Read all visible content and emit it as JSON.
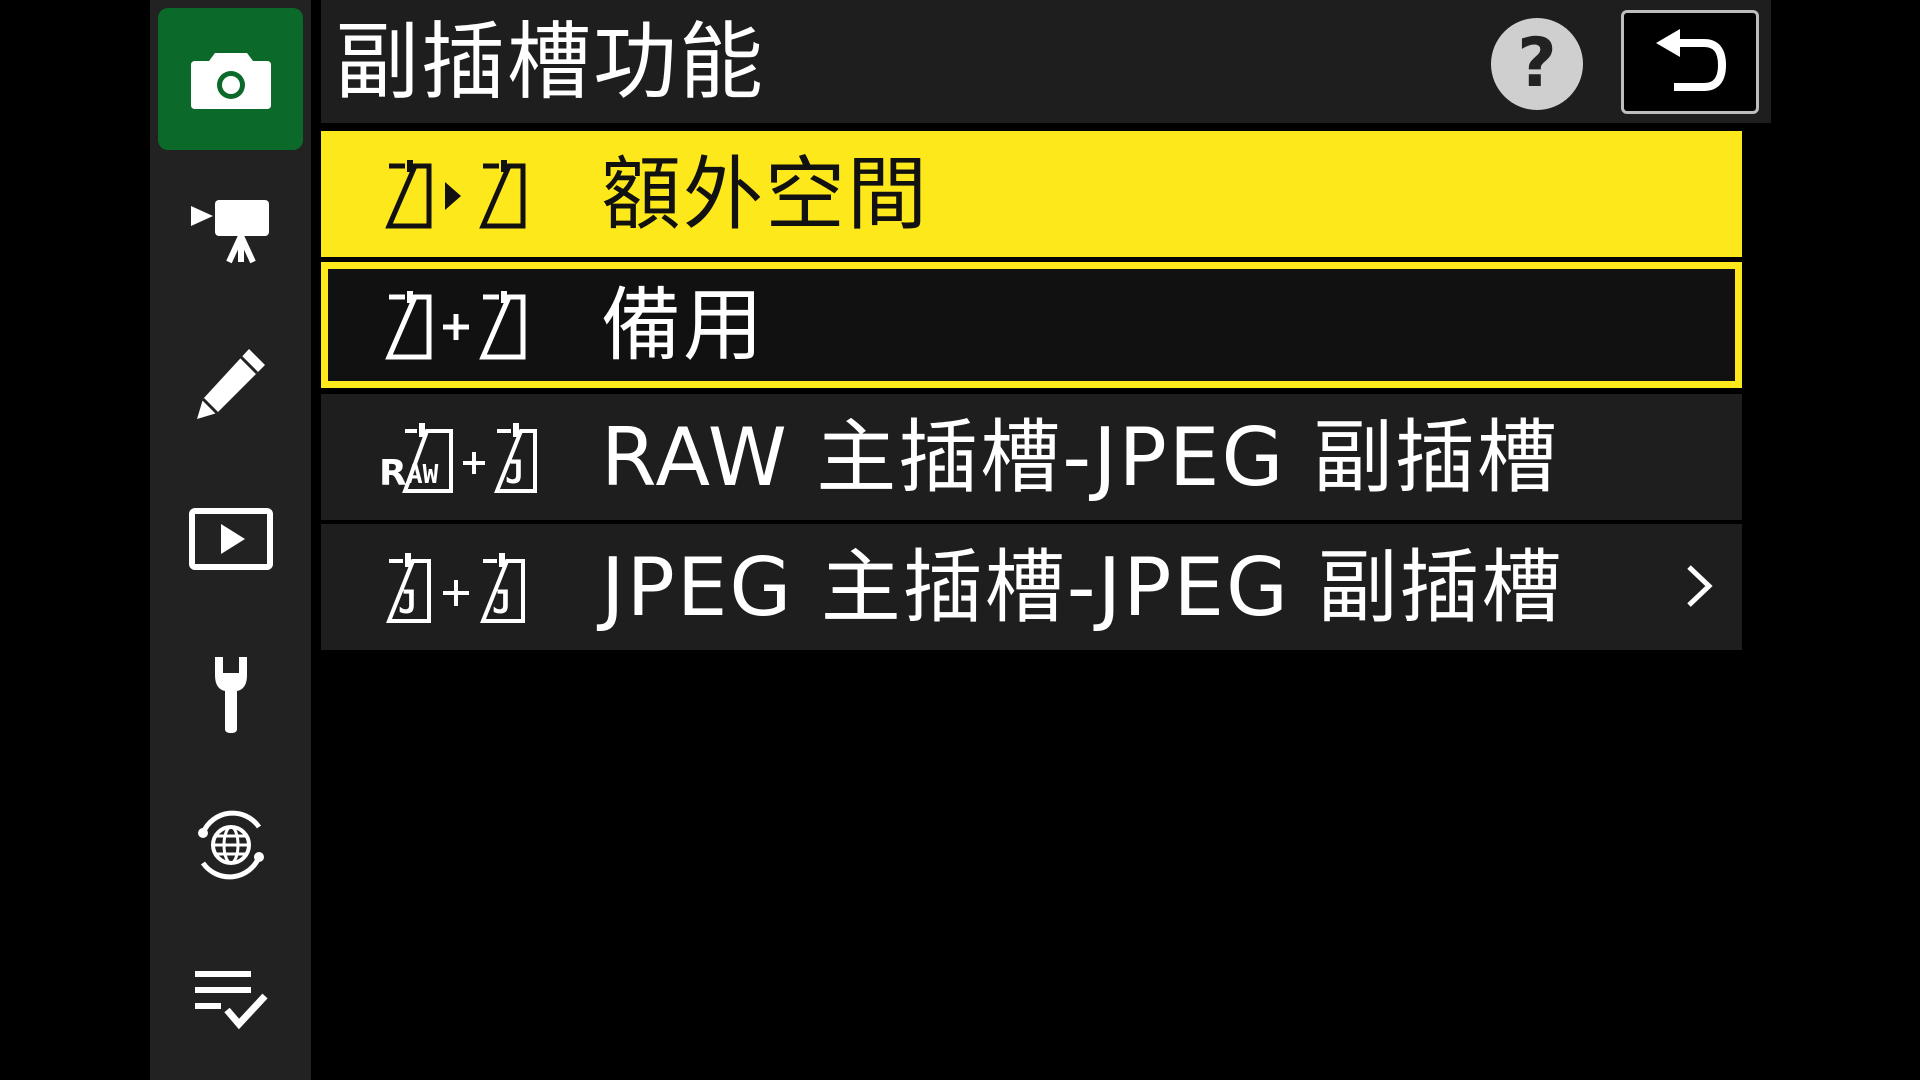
{
  "colors": {
    "accent_yellow": "#fde81b",
    "active_tab_green": "#0b6a2a",
    "panel_dark": "#1e1e1e",
    "sidebar": "#222222"
  },
  "sidebar": {
    "items": [
      {
        "name": "photo-shooting-menu",
        "icon": "camera-icon",
        "active": true
      },
      {
        "name": "movie-recording-menu",
        "icon": "movie-camera-icon",
        "active": false
      },
      {
        "name": "custom-settings-menu",
        "icon": "pencil-icon",
        "active": false
      },
      {
        "name": "playback-menu",
        "icon": "play-icon",
        "active": false
      },
      {
        "name": "setup-menu",
        "icon": "wrench-icon",
        "active": false
      },
      {
        "name": "network-menu",
        "icon": "network-globe-icon",
        "active": false
      },
      {
        "name": "my-menu",
        "icon": "list-check-icon",
        "active": false
      }
    ]
  },
  "header": {
    "title": "副插槽功能",
    "help_icon": "help-icon",
    "back_icon": "back-arrow-icon"
  },
  "menu": {
    "items": [
      {
        "label": "額外空間",
        "icon": "slot-overflow-icon",
        "state": "highlighted"
      },
      {
        "label": "備用",
        "icon": "slot-backup-icon",
        "state": "selected"
      },
      {
        "label": "RAW 主插槽-JPEG 副插槽",
        "icon": "raw-jpeg-slot-icon",
        "state": "normal"
      },
      {
        "label": "JPEG 主插槽-JPEG 副插槽",
        "icon": "jpeg-jpeg-slot-icon",
        "state": "normal",
        "submenu": true
      }
    ]
  }
}
